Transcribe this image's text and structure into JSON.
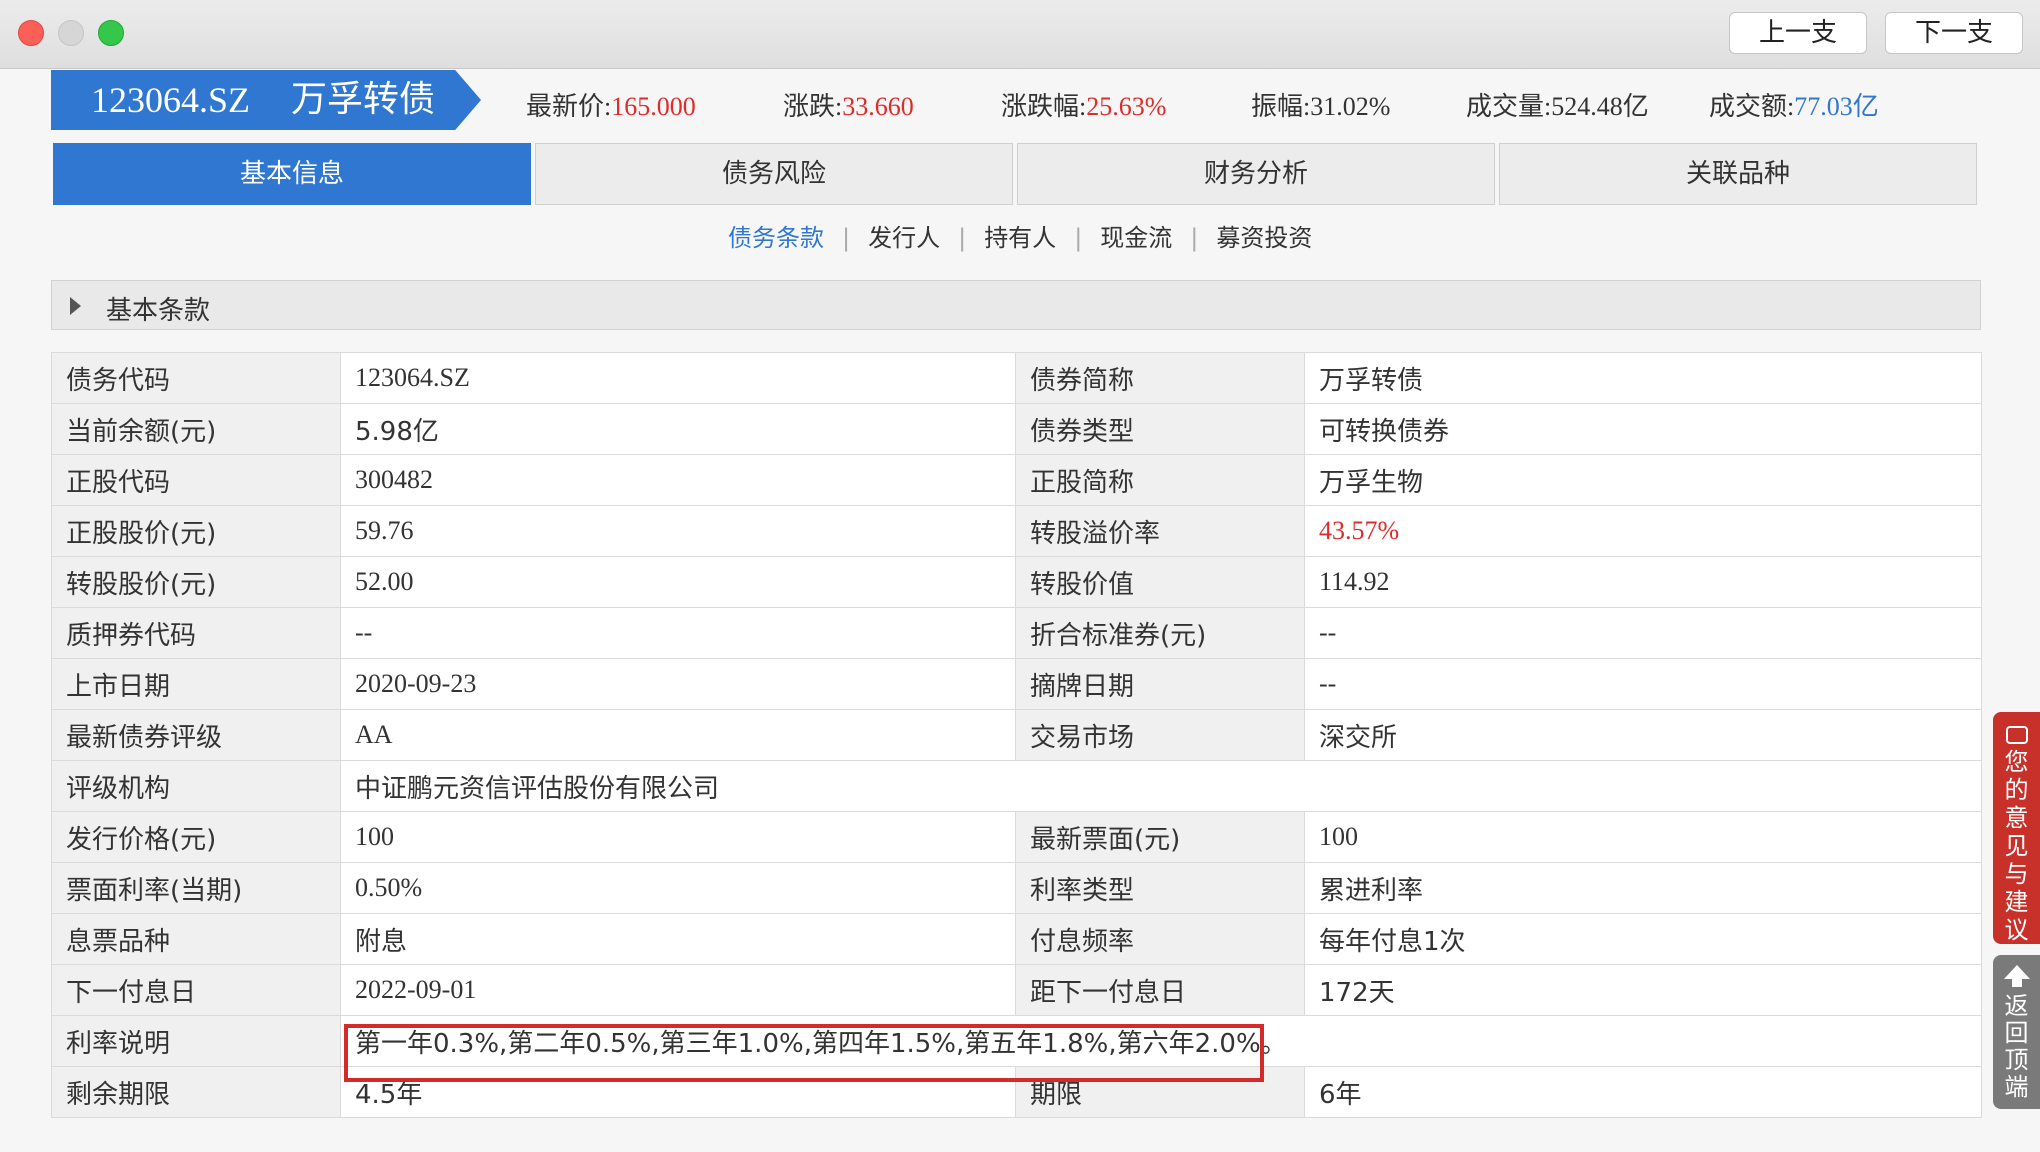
{
  "window": {
    "prev_label": "上一支",
    "next_label": "下一支"
  },
  "bond": {
    "code": "123064.SZ",
    "name": "万孚转债"
  },
  "quote": {
    "latest_price_label": "最新价:",
    "latest_price": "165.000",
    "change_label": "涨跌:",
    "change": "33.660",
    "change_pct_label": "涨跌幅:",
    "change_pct": "25.63%",
    "amplitude_label": "振幅:",
    "amplitude": "31.02%",
    "volume_label": "成交量:",
    "volume": "524.48亿",
    "turnover_label": "成交额:",
    "turnover": "77.03亿"
  },
  "tabs": [
    {
      "label": "基本信息",
      "active": true
    },
    {
      "label": "债务风险",
      "active": false
    },
    {
      "label": "财务分析",
      "active": false
    },
    {
      "label": "关联品种",
      "active": false
    }
  ],
  "subnav": [
    {
      "label": "债务条款",
      "active": true
    },
    {
      "label": "发行人",
      "active": false
    },
    {
      "label": "持有人",
      "active": false
    },
    {
      "label": "现金流",
      "active": false
    },
    {
      "label": "募资投资",
      "active": false
    }
  ],
  "section": {
    "title": "基本条款"
  },
  "rows": [
    {
      "k1": "债务代码",
      "v1": "123064.SZ",
      "k2": "债券简称",
      "v2": "万孚转债"
    },
    {
      "k1": "当前余额(元)",
      "v1": "5.98亿",
      "k2": "债券类型",
      "v2": "可转换债券"
    },
    {
      "k1": "正股代码",
      "v1": "300482",
      "k2": "正股简称",
      "v2": "万孚生物"
    },
    {
      "k1": "正股股价(元)",
      "v1": "59.76",
      "k2": "转股溢价率",
      "v2": "43.57%"
    },
    {
      "k1": "转股股价(元)",
      "v1": "52.00",
      "k2": "转股价值",
      "v2": "114.92"
    },
    {
      "k1": "质押券代码",
      "v1": "--",
      "k2": "折合标准券(元)",
      "v2": "--"
    },
    {
      "k1": "上市日期",
      "v1": "2020-09-23",
      "k2": "摘牌日期",
      "v2": "--"
    },
    {
      "k1": "最新债券评级",
      "v1": "AA",
      "k2": "交易市场",
      "v2": "深交所"
    },
    {
      "k1": "评级机构",
      "v1": "中证鹏元资信评估股份有限公司"
    },
    {
      "k1": "发行价格(元)",
      "v1": "100",
      "k2": "最新票面(元)",
      "v2": "100"
    },
    {
      "k1": "票面利率(当期)",
      "v1": "0.50%",
      "k2": "利率类型",
      "v2": "累进利率"
    },
    {
      "k1": "息票品种",
      "v1": "附息",
      "k2": "付息频率",
      "v2": "每年付息1次"
    },
    {
      "k1": "下一付息日",
      "v1": "2022-09-01",
      "k2": "距下一付息日",
      "v2": "172天"
    },
    {
      "k1": "利率说明",
      "v1": "第一年0.3%,第二年0.5%,第三年1.0%,第四年1.5%,第五年1.8%,第六年2.0%。"
    },
    {
      "k1": "剩余期限",
      "v1": "4.5年",
      "k2": "期限",
      "v2": "6年"
    }
  ],
  "side": {
    "feedback_label": "您的意见与建议",
    "top_label": "返回顶端"
  },
  "colors": {
    "accent_blue": "#2f77d1",
    "price_red": "#e02b2b",
    "highlight_red": "#d32a2a"
  }
}
